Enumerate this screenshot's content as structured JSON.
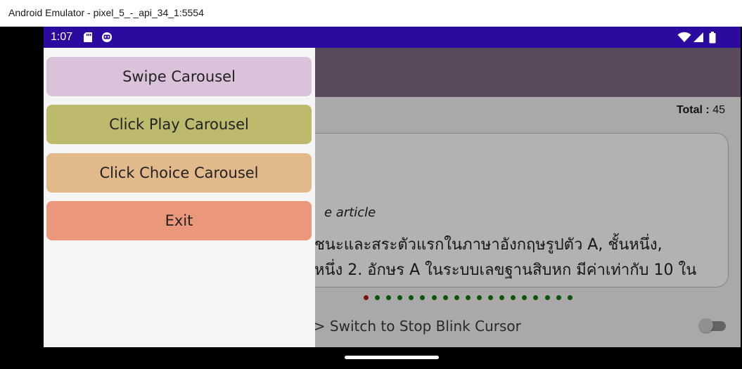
{
  "window": {
    "title": "Android Emulator - pixel_5_-_api_34_1:5554"
  },
  "statusbar": {
    "time": "1:07",
    "left_icons": [
      "sd-card-icon",
      "notification-icon"
    ],
    "right_icons": [
      "wifi-icon",
      "signal-icon",
      "battery-icon"
    ],
    "color": "#2b0aa0"
  },
  "drawer": {
    "items": [
      {
        "label": "Swipe Carousel",
        "color": "#d9c2da"
      },
      {
        "label": "Click Play Carousel",
        "color": "#bdba6e"
      },
      {
        "label": "Click Choice Carousel",
        "color": "#e1b98a"
      },
      {
        "label": "Exit",
        "color": "#eb977c"
      }
    ]
  },
  "content": {
    "appbar_color": "#5a4a5b",
    "total_label": "Total :",
    "total_value": "45",
    "card": {
      "subtitle": "e article",
      "line1": "ชนะและสระตัวแรกในภาษาอังกฤษรูปตัว A, ชั้นหนึ่ง,",
      "line2": "หนึ่ง 2. อักษร A ในระบบเลขฐานสิบหก มีค่าเท่ากับ 10 ใน"
    },
    "pagination": {
      "count": 19,
      "active_index": 0,
      "active_color": "#b31a1a",
      "inactive_color": "#0d7a0d"
    },
    "switch": {
      "label": "h => Switch to Stop Blink Cursor",
      "state": "off"
    }
  }
}
